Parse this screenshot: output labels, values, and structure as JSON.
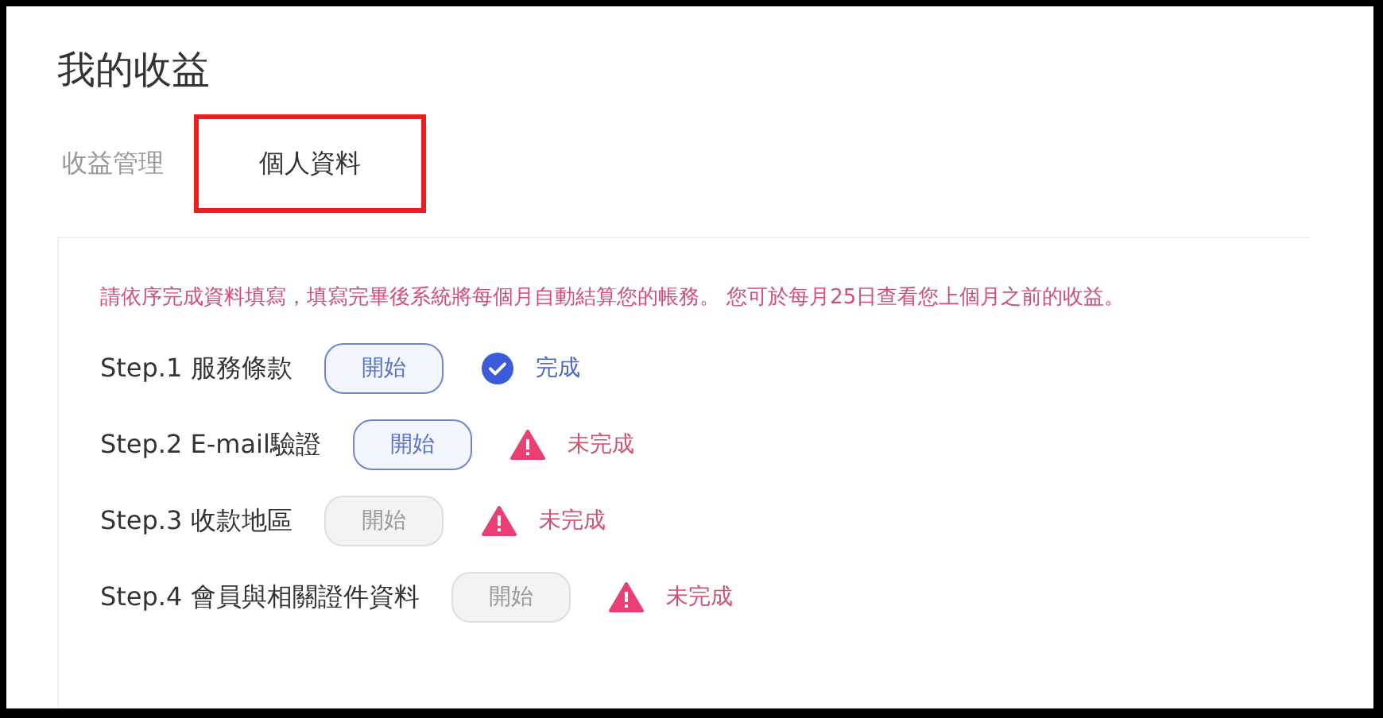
{
  "page_title": "我的收益",
  "tabs": [
    {
      "label": "收益管理",
      "selected": false,
      "highlighted": false
    },
    {
      "label": "個人資料",
      "selected": true,
      "highlighted": true
    }
  ],
  "notice": "請依序完成資料填寫，填寫完畢後系統將每個月自動結算您的帳務。 您可於每月25日查看您上個月之前的收益。",
  "steps": [
    {
      "label": "Step.1 服務條款",
      "button": "開始",
      "disabled": false,
      "status": {
        "kind": "done",
        "text": "完成"
      }
    },
    {
      "label": "Step.2 E-mail驗證",
      "button": "開始",
      "disabled": false,
      "status": {
        "kind": "pending",
        "text": "未完成"
      }
    },
    {
      "label": "Step.3 收款地區",
      "button": "開始",
      "disabled": true,
      "status": {
        "kind": "pending",
        "text": "未完成"
      }
    },
    {
      "label": "Step.4 會員與相關證件資料",
      "button": "開始",
      "disabled": true,
      "status": {
        "kind": "pending",
        "text": "未完成"
      }
    }
  ]
}
